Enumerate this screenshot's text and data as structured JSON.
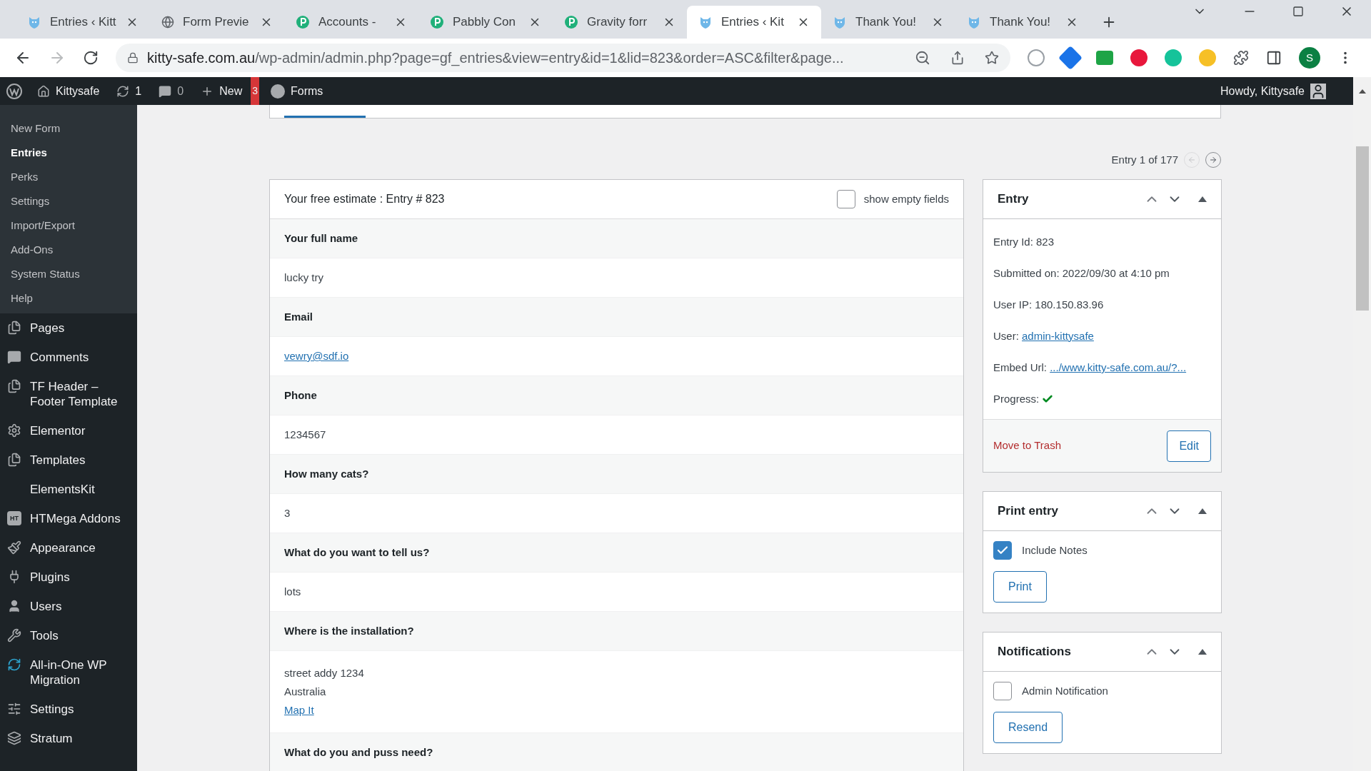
{
  "browser": {
    "tabs": [
      {
        "title": "Entries ‹ Kitt",
        "kind": "cat",
        "selected": false
      },
      {
        "title": "Form Previe",
        "kind": "globe",
        "selected": false
      },
      {
        "title": "Accounts - ",
        "kind": "pabbly",
        "selected": false
      },
      {
        "title": "Pabbly Con",
        "kind": "pabbly",
        "selected": false
      },
      {
        "title": "Gravity forr",
        "kind": "pabbly",
        "selected": false
      },
      {
        "title": "Entries ‹ Kit",
        "kind": "cat",
        "selected": true
      },
      {
        "title": "Thank You!",
        "kind": "cat",
        "selected": false
      },
      {
        "title": "Thank You!",
        "kind": "cat",
        "selected": false
      }
    ],
    "url_host": "kitty-safe.com.au",
    "url_path": "/wp-admin/admin.php?page=gf_entries&view=entry&id=1&lid=823&order=ASC&filter&page...",
    "profile": "S"
  },
  "admin_bar": {
    "site": "Kittysafe",
    "updates": "1",
    "comments": "0",
    "new": "New",
    "alert": "3",
    "forms": "Forms",
    "howdy": "Howdy, Kittysafe"
  },
  "sidebar": {
    "submenu": [
      {
        "label": "New Form",
        "selected": false
      },
      {
        "label": "Entries",
        "selected": true
      },
      {
        "label": "Perks",
        "selected": false
      },
      {
        "label": "Settings",
        "selected": false
      },
      {
        "label": "Import/Export",
        "selected": false
      },
      {
        "label": "Add-Ons",
        "selected": false
      },
      {
        "label": "System Status",
        "selected": false
      },
      {
        "label": "Help",
        "selected": false
      }
    ],
    "items": [
      {
        "label": "Pages",
        "kind": "pages"
      },
      {
        "label": "Comments",
        "kind": "comment"
      },
      {
        "label": "TF Header – Footer Template",
        "kind": "pages"
      },
      {
        "label": "Elementor",
        "kind": "gear"
      },
      {
        "label": "Templates",
        "kind": "pages"
      },
      {
        "label": "ElementsKit",
        "kind": "none"
      },
      {
        "label": "HTMega Addons",
        "kind": "badge",
        "badge": "HT"
      },
      {
        "label": "Appearance",
        "kind": "brush"
      },
      {
        "label": "Plugins",
        "kind": "plug"
      },
      {
        "label": "Users",
        "kind": "user"
      },
      {
        "label": "Tools",
        "kind": "wrench"
      },
      {
        "label": "All-in-One WP Migration",
        "kind": "refresh"
      },
      {
        "label": "Settings",
        "kind": "sliders"
      },
      {
        "label": "Stratum",
        "kind": "stratum"
      }
    ]
  },
  "pager": {
    "label": "Entry 1 of 177"
  },
  "entry_panel": {
    "title": "Your free estimate : Entry # 823",
    "show_empty": {
      "label": "show empty fields",
      "checked": false
    },
    "fields": [
      {
        "label": "Your full name",
        "kind": "text",
        "lines": [
          "lucky try"
        ]
      },
      {
        "label": "Email",
        "kind": "link",
        "lines": [
          "vewry@sdf.io"
        ]
      },
      {
        "label": "Phone",
        "kind": "text",
        "lines": [
          "1234567"
        ]
      },
      {
        "label": "How many cats?",
        "kind": "text",
        "lines": [
          "3"
        ]
      },
      {
        "label": "What do you want to tell us?",
        "kind": "text",
        "lines": [
          "lots"
        ]
      },
      {
        "label": "Where is the installation?",
        "kind": "address",
        "lines": [
          "street addy 1234",
          "Australia"
        ],
        "link": "Map It"
      },
      {
        "label": "What do you and puss need?",
        "kind": "none"
      }
    ]
  },
  "entry_box": {
    "title": "Entry",
    "details": [
      {
        "label": "Entry Id: 823",
        "kind": "text"
      },
      {
        "label": "Submitted on: 2022/09/30 at 4:10 pm",
        "kind": "text"
      },
      {
        "label": "User IP: 180.150.83.96",
        "kind": "text"
      },
      {
        "label": "User: ",
        "kind": "link",
        "link": "admin-kittysafe"
      },
      {
        "label": "Embed Url: ",
        "kind": "link",
        "link": ".../www.kitty-safe.com.au/?..."
      },
      {
        "label": "Progress: ",
        "kind": "check"
      }
    ],
    "trash": "Move to Trash",
    "edit": "Edit"
  },
  "print_box": {
    "title": "Print entry",
    "option": {
      "label": "Include Notes",
      "checked": true
    },
    "button": "Print"
  },
  "notify_box": {
    "title": "Notifications",
    "option": {
      "label": "Admin Notification",
      "checked": false
    },
    "button": "Resend"
  }
}
